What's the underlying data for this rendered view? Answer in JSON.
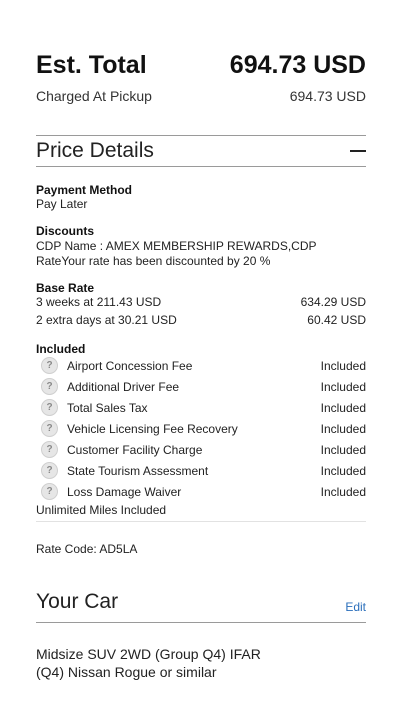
{
  "summary": {
    "total_label": "Est. Total",
    "total_amount": "694.73 USD",
    "charged_label": "Charged At Pickup",
    "charged_amount": "694.73 USD"
  },
  "price_details": {
    "title": "Price Details",
    "payment_method": {
      "title": "Payment Method",
      "value": "Pay Later"
    },
    "discounts": {
      "title": "Discounts",
      "text": "CDP Name : AMEX MEMBERSHIP REWARDS,CDP RateYour rate has been discounted by 20 %"
    },
    "base_rate": {
      "title": "Base Rate",
      "rows": [
        {
          "label": "3 weeks at 211.43 USD",
          "amount": "634.29 USD"
        },
        {
          "label": "2 extra days at 30.21 USD",
          "amount": "60.42 USD"
        }
      ]
    },
    "included": {
      "title": "Included",
      "items": [
        {
          "label": "Airport Concession Fee",
          "status": "Included"
        },
        {
          "label": "Additional Driver Fee",
          "status": "Included"
        },
        {
          "label": "Total Sales Tax",
          "status": "Included"
        },
        {
          "label": "Vehicle Licensing Fee Recovery",
          "status": "Included"
        },
        {
          "label": "Customer Facility Charge",
          "status": "Included"
        },
        {
          "label": "State Tourism Assessment",
          "status": "Included"
        },
        {
          "label": "Loss Damage Waiver",
          "status": "Included"
        }
      ],
      "miles": "Unlimited Miles Included"
    },
    "rate_code": "Rate Code: AD5LA"
  },
  "your_car": {
    "title": "Your Car",
    "edit_label": "Edit",
    "line1": "Midsize SUV 2WD (Group Q4) IFAR",
    "line2": "(Q4) Nissan Rogue or similar"
  },
  "icons": {
    "info": "question-mark-icon",
    "collapse": "minus-icon"
  },
  "colors": {
    "link": "#2a6ebb",
    "divider": "#9a9a9a"
  }
}
